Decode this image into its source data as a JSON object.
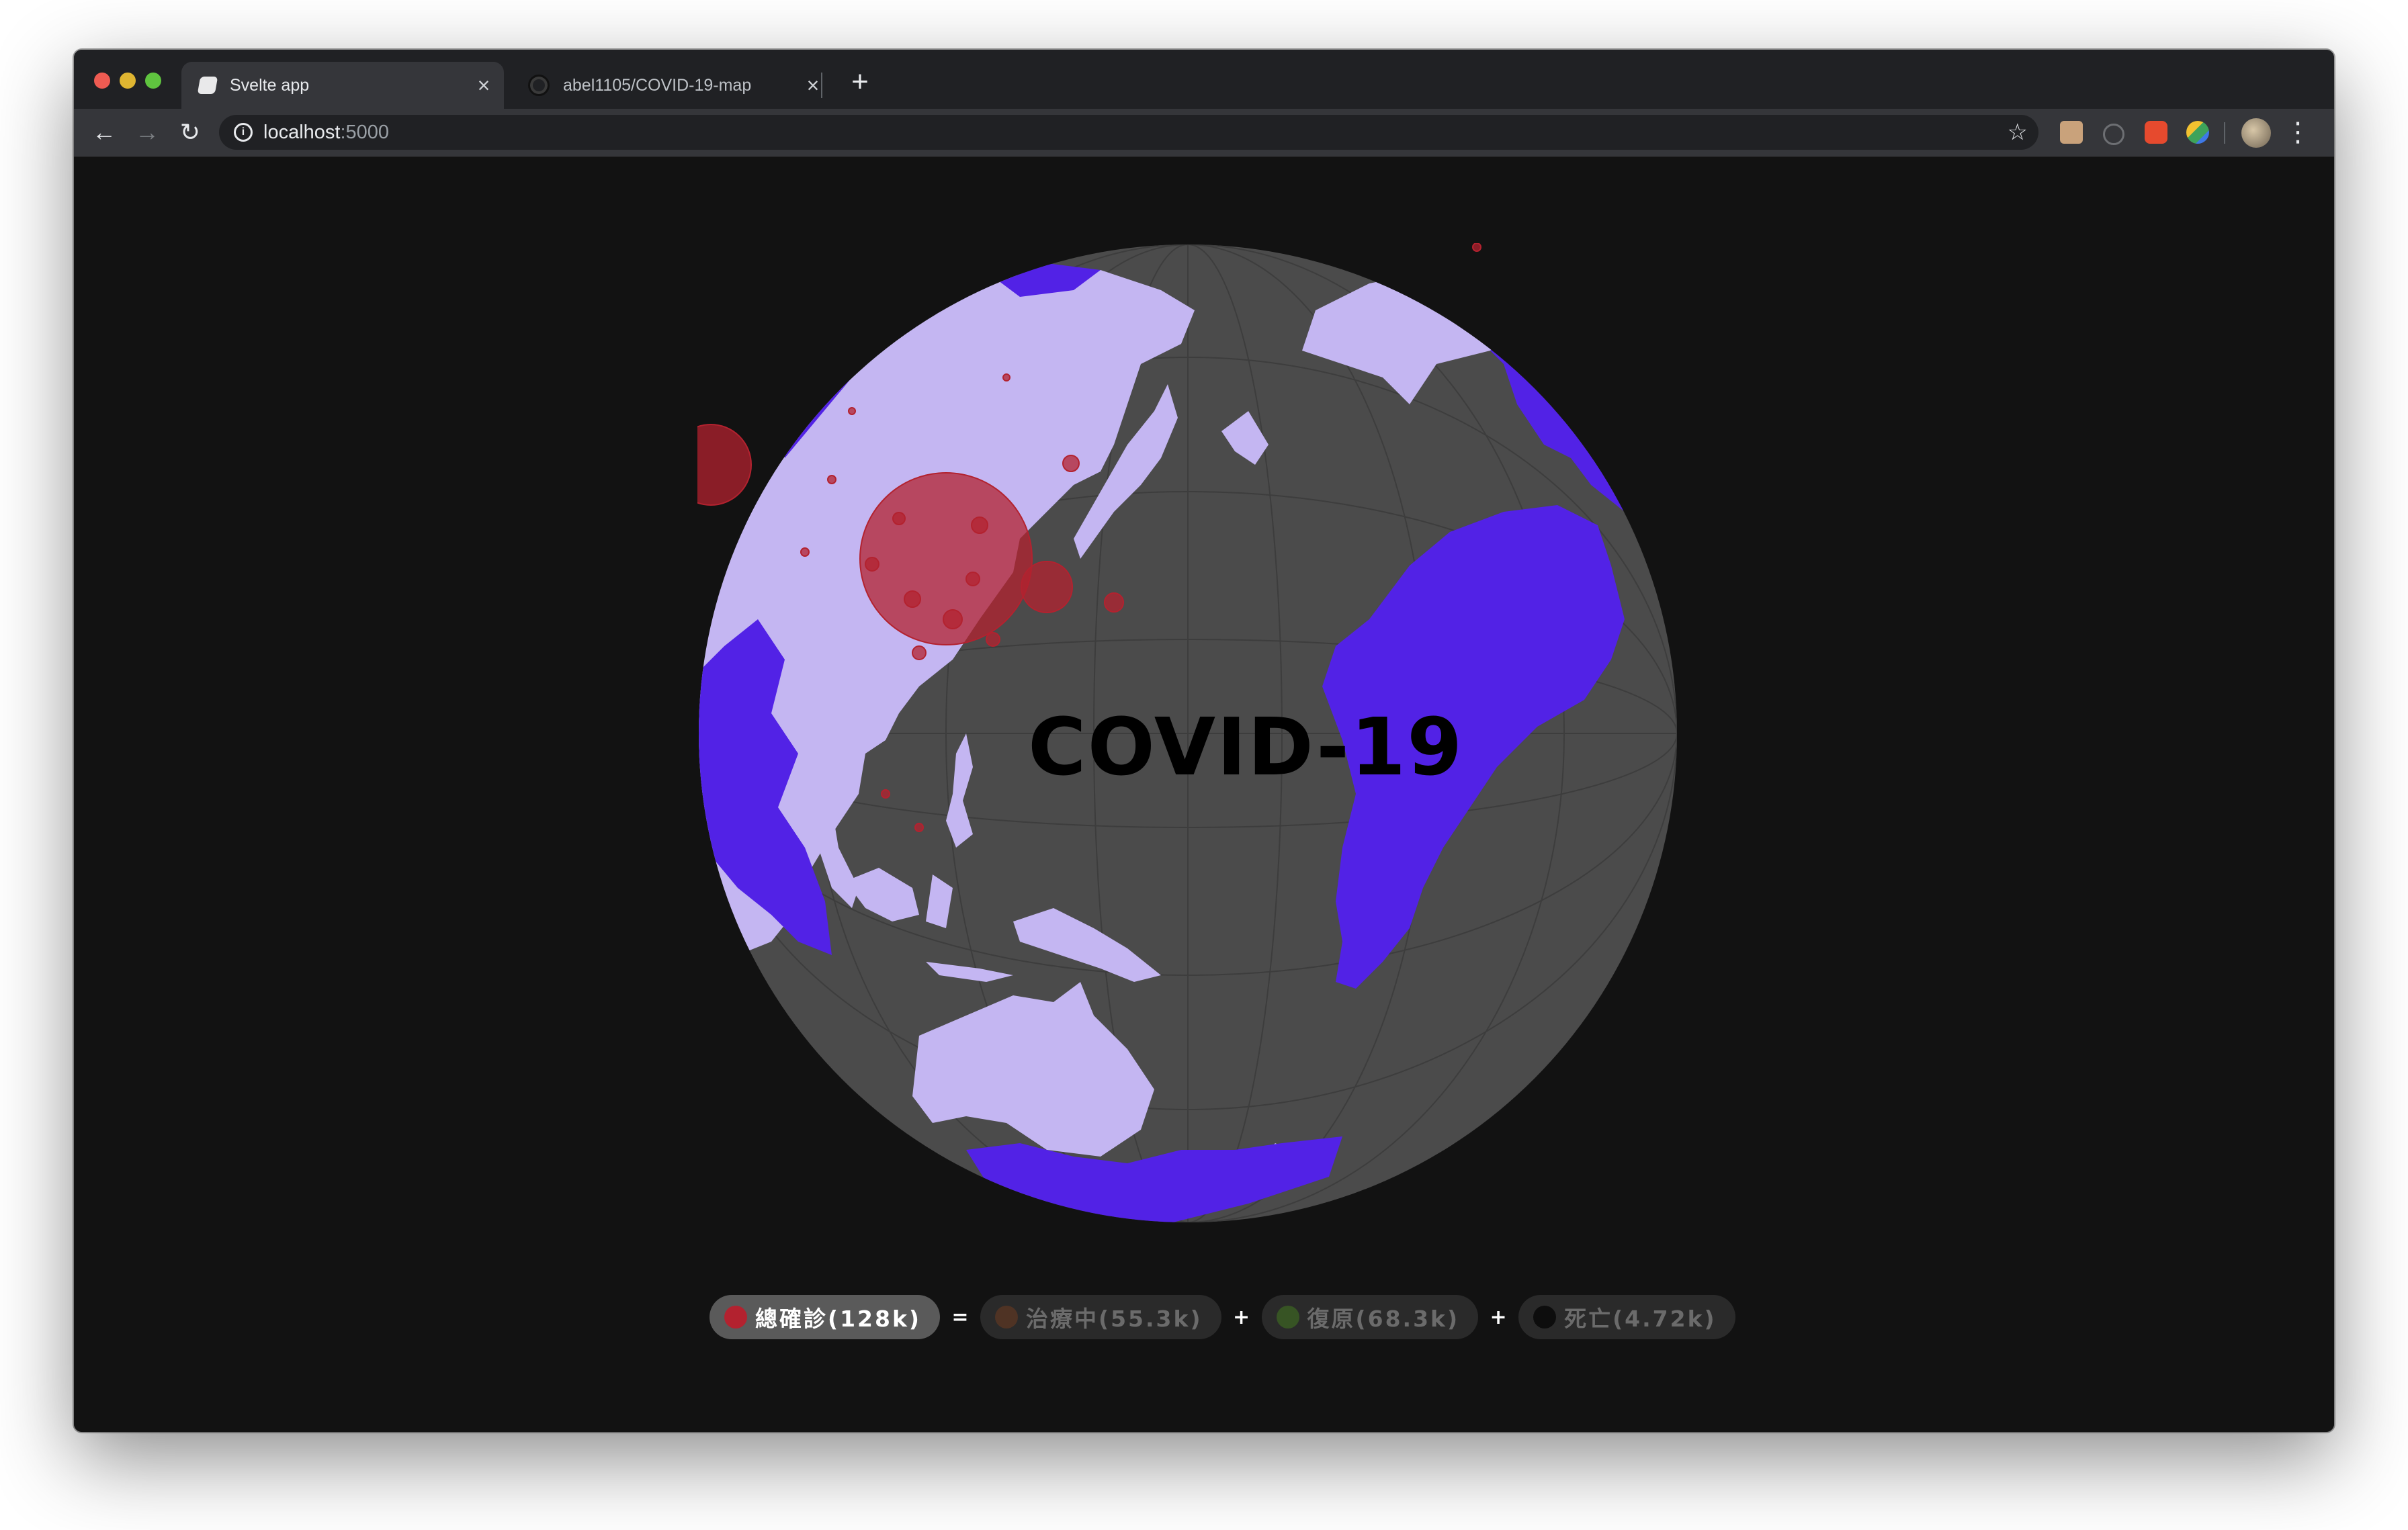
{
  "browser": {
    "tabs": [
      {
        "title": "Svelte app",
        "active": true
      },
      {
        "title": "abel1105/COVID-19-map",
        "active": false
      }
    ],
    "address": {
      "host": "localhost",
      "port": ":5000"
    }
  },
  "page": {
    "headline": "COVID-19",
    "legend": {
      "items": [
        {
          "label": "總確診(128k)",
          "color": "#b3222f",
          "text_color": "#ffffff"
        },
        {
          "label": "治療中(55.3k)",
          "color": "#4f3324",
          "text_color": "#6b6b6b"
        },
        {
          "label": "復原(68.3k)",
          "color": "#375424",
          "text_color": "#6b6b6b"
        },
        {
          "label": "死亡(4.72k)",
          "color": "#0d0d0d",
          "text_color": "#6b6b6b"
        }
      ],
      "operators": [
        "=",
        "+",
        "+"
      ]
    },
    "colors": {
      "ocean": "#4b4b4b",
      "land_affected": "#c4b6f2",
      "land_unaffected": "#5222e6",
      "case_bubble": "#b3222f"
    }
  }
}
